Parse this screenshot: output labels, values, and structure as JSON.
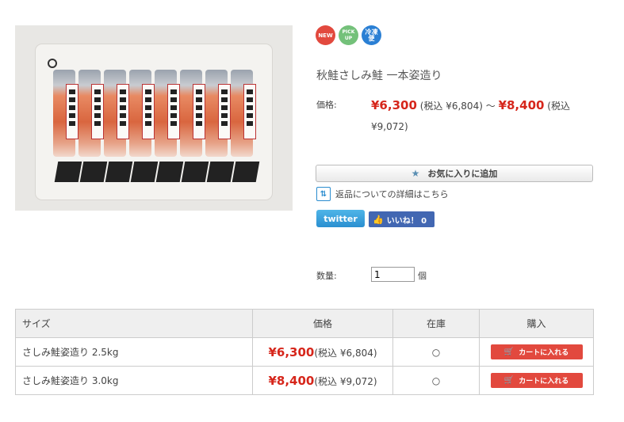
{
  "product": {
    "image_alt": "秋鮭さしみ鮭 一本姿造り",
    "badges": {
      "new": "NEW",
      "pick_top": "PICK",
      "pick_bottom": "UP",
      "frozen_top": "冷凍",
      "frozen_bottom": "便"
    },
    "title": "秋鮭さしみ鮭 一本姿造り",
    "price_label": "価格:",
    "price_min": "¥6,300",
    "price_min_tax": "(税込 ¥6,804)",
    "price_separator": "～",
    "price_max": "¥8,400",
    "price_max_tax_prefix": "(税込",
    "price_max_tax_value": "¥9,072)"
  },
  "actions": {
    "favorite_label": "お気に入りに追加",
    "return_policy_label": "返品についての詳細はこちら",
    "twitter_label": "twitter",
    "facebook_label": "いいね！ 0"
  },
  "quantity": {
    "label": "数量:",
    "value": "1",
    "unit": "個"
  },
  "variants_table": {
    "headers": [
      "サイズ",
      "価格",
      "在庫",
      "購入"
    ],
    "rows": [
      {
        "size": "さしみ鮭姿造り 2.5kg",
        "price": "¥6,300",
        "tax": "(税込 ¥6,804)",
        "stock": "○",
        "buy_label": "カートに入れる"
      },
      {
        "size": "さしみ鮭姿造り 3.0kg",
        "price": "¥8,400",
        "tax": "(税込 ¥9,072)",
        "stock": "○",
        "buy_label": "カートに入れる"
      }
    ]
  },
  "colors": {
    "price_red": "#d6261b",
    "cart_button": "#e2493e",
    "badge_new": "#e2493e",
    "badge_pick": "#74c17a",
    "badge_frozen": "#2a7fd4",
    "twitter": "#2a8fd0",
    "facebook": "#4267b2"
  },
  "icons": {
    "favorite": "star-icon",
    "return": "return-arrows-icon",
    "facebook": "thumbs-up-icon",
    "cart": "cart-icon"
  }
}
